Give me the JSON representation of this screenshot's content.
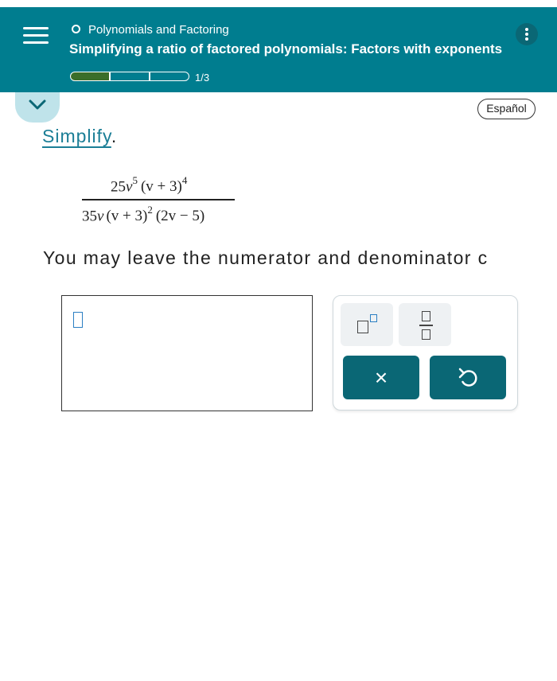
{
  "header": {
    "topic": "Polynomials and Factoring",
    "subtitle": "Simplifying a ratio of factored polynomials: Factors with exponents",
    "progress": {
      "label": "1/3",
      "current": 1,
      "total": 3
    }
  },
  "language_button": "Español",
  "prompt": {
    "word": "Simplify",
    "punct": "."
  },
  "expression": {
    "numerator": {
      "coef": "25",
      "var": "v",
      "exp1": "5",
      "factor": "(v + 3)",
      "exp2": "4"
    },
    "denominator": {
      "coef": "35",
      "var": "v",
      "factor1": "(v + 3)",
      "exp": "2",
      "factor2": "(2v − 5)"
    }
  },
  "instruction": "You may leave the numerator and denominator c",
  "keypad": {
    "clear_label": "×",
    "undo_icon": "undo-icon",
    "exponent_icon": "exponent-template-icon",
    "fraction_icon": "fraction-template-icon"
  },
  "colors": {
    "header": "#007d8f",
    "button_dark": "#0a6775",
    "progress_fill": "#3b6e2a",
    "link": "#1b7e96"
  }
}
